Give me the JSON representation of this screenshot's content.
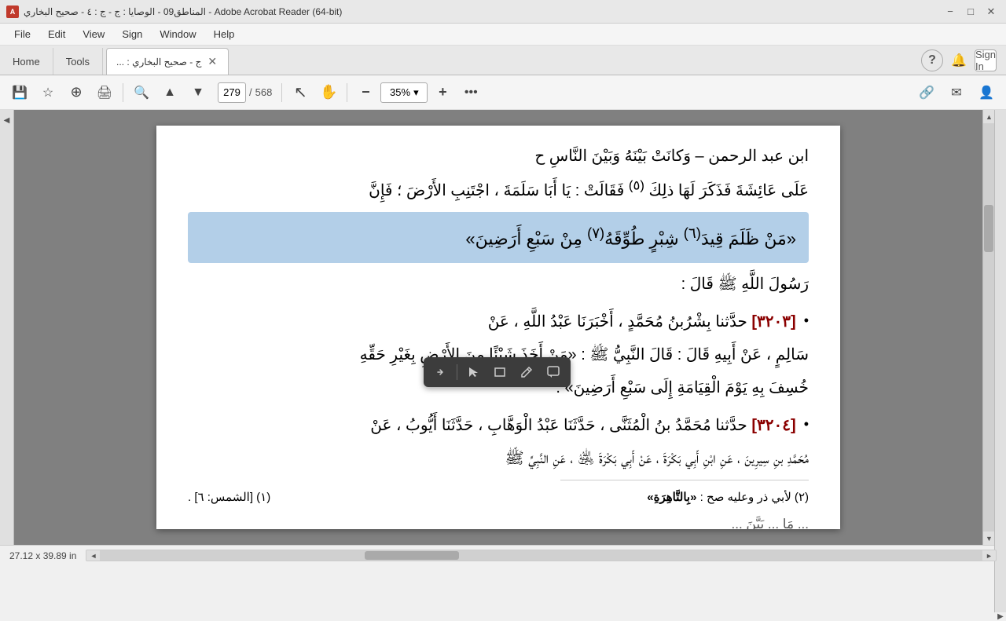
{
  "titlebar": {
    "title": "المناطق09 - الوصايا : ج - ج : ٤ - صحيح البخاري - Adobe Acrobat Reader (64-bit)",
    "icon": "A",
    "minimize_label": "−",
    "maximize_label": "□",
    "close_label": "✕"
  },
  "menubar": {
    "items": [
      "File",
      "Edit",
      "View",
      "Sign",
      "Window",
      "Help"
    ]
  },
  "tabbar": {
    "home_label": "Home",
    "tools_label": "Tools",
    "doc_tab_label": "... : ج - صحيح البخاري",
    "help_icon": "?",
    "bell_icon": "🔔",
    "signin_label": "Sign In"
  },
  "toolbar": {
    "save_icon": "💾",
    "bookmark_icon": "☆",
    "upload_icon": "⊙",
    "print_icon": "🖨",
    "search_icon": "🔍",
    "prev_icon": "▲",
    "next_icon": "▼",
    "page_current": "279",
    "page_sep": "/",
    "page_total": "568",
    "cursor_icon": "↖",
    "hand_icon": "✋",
    "zoom_out_icon": "−",
    "zoom_in_icon": "+",
    "zoom_value": "35%",
    "zoom_arrow": "▾",
    "more_icon": "•••",
    "link_icon": "🔗",
    "share_icon": "✉",
    "user_icon": "👤"
  },
  "float_toolbar": {
    "comment_icon": "💬",
    "pen_icon": "✏",
    "box_icon": "▣",
    "cursor_icon": "↖",
    "sep": "|",
    "arrow_icon": "➤"
  },
  "content": {
    "line1": "ابن عبد الرحمن – وَكانَتْ بَيْنَهُ وَبَيْنَ النَّاسِ ح",
    "line2": "عَلَى عَائِشَةَ فَذَكَرَ لَهَا ذلِكَ",
    "line2b": "فَقَالَتْ : يَا أَبَا سَلَمَةَ ، اجْتَنِبِ الأَرْضَ ؛ فَإِنَّ",
    "line3_highlighted": "«مَنْ ظَلَمَ قِيدَ",
    "line3_sup1": "(٦)",
    "line3_mid": "شِبْرٍ طُوِّقَهُ",
    "line3_sup2": "(٧)",
    "line3_end": "مِنْ سَبْعِ أَرَضِينَ»",
    "line4_prefix": ": قَالَ",
    "line4": "رَسُولَ اللَّهِ ﷺ قَالَ",
    "hadith_num1": "[٣٢٠٣]",
    "hadith_text1": "حدَّثنا بِشْرُبنُ مُحَمَّدٍ ، أَخْبَرَنَا عَبْدُ اللَّهِ ، عَنْ",
    "line5": "سَالِمٍ ، عَنْ أَبِيهِ قَالَ : قَالَ النَّبِيُّ ﷺ : «مَنْ أَخَذَ شَيْئًا مِنَ الأَرْضِ بِغَيْرِ حَقِّهِ",
    "line6": "خُسِفَ بِهِ يَوْمَ الْقِيَامَةِ إِلَى سَبْعِ أَرَضِينَ» .",
    "hadith_num2": "[٣٢٠٤]",
    "hadith_text2": "حدَّثنا مُحَمَّدُ بنُ الْمُثَنَّى ، حَدَّثَنَا عَبْدُ الْوَهَّابِ ، حَدَّثَنَا أَيُّوبُ ، عَنْ",
    "line7": "مُحَمَّدِ بنِ سِيرِينَ ، عَنِ ابْنِ أَبِي بَكْرَةَ ، عَنْ أَبِي بَكْرَةَ ﵁ ، عَنِ النَّبِيِّ ﷺ",
    "footnote1": "(١) [الشمس: ٦] .",
    "footnote2": "(٢) لأبي ذر وعليه صح :",
    "footnote3": "«بِالتَّاهِرَةِ»"
  },
  "statusbar": {
    "dimensions": "27.12 x 39.89 in",
    "scroll_left": "◄",
    "scroll_right": "►"
  },
  "colors": {
    "highlight_bg": "#c5ddf5",
    "accent_blue": "#005a9e",
    "toolbar_bg": "#f5f5f5",
    "hadith_red": "#8b0000"
  }
}
